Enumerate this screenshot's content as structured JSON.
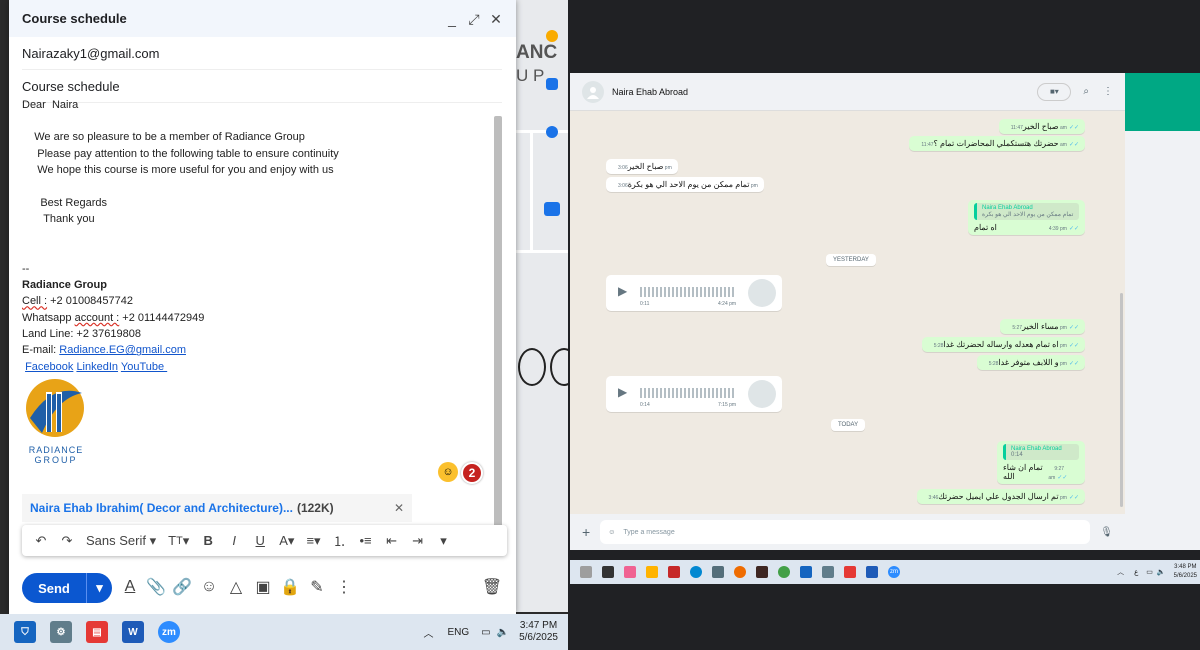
{
  "compose": {
    "title": "Course schedule",
    "to": "Nairazaky1@gmail.com",
    "subject": "Course schedule",
    "body_lines": [
      "Dear  Naira",
      "",
      "    We are so pleasure to be a member of Radiance Group",
      "     Please pay attention to the following table to ensure continuity",
      "     We hope this course is more useful for you and enjoy with us",
      "",
      "      Best Regards",
      "       Thank you",
      "",
      "",
      "--"
    ],
    "signature": {
      "company": "Radiance Group",
      "cell_label": "Cell :",
      "cell_value": " +2 01008457742",
      "whatsapp_label": "Whatsapp ",
      "whatsapp_account": "account :",
      "whatsapp_value": " +2 01144472949",
      "landline": "Land Line: +2 37619808",
      "email_label": "E-mail: ",
      "email_value": "Radiance.EG@gmail.com",
      "links": [
        "Facebook",
        "LinkedIn",
        "YouTube "
      ],
      "logo_text_1": "RADIANCE",
      "logo_text_2": "GROUP"
    },
    "badge_count": "2",
    "attachment_name": "Naira Ehab Ibrahim( Decor and Architecture)...",
    "attachment_size": "(122K)",
    "font_select": "Sans Serif",
    "send_label": "Send"
  },
  "map_letters": [
    "ANC",
    "U P"
  ],
  "taskbar_left": {
    "lang": "ENG",
    "time": "3:47 PM",
    "date": "5/6/2025",
    "zoom_label": "zm"
  },
  "chat": {
    "contact": "Naira Ehab Abroad",
    "messages": [
      {
        "dir": "out",
        "text": "صباح الخير",
        "time": "11:47 am"
      },
      {
        "dir": "out",
        "text": "حضرتك هتستكملي المحاضرات تمام ؟",
        "time": "11:47 am"
      },
      {
        "dir": "in",
        "text": "صباح الخير",
        "time": "3:06 pm"
      },
      {
        "dir": "in",
        "text": "تمام ممكن من يوم الاحد الي هو بكرة",
        "time": "3:06 pm"
      },
      {
        "dir": "out",
        "quote_name": "Naira Ehab Abroad",
        "quote_text": "تمام ممكن من يوم الاحد الي هو بكرة",
        "text": "اه تمام",
        "time": "4:39 pm"
      },
      {
        "dir": "out",
        "text": "مساء الخير",
        "time": "5:27 pm"
      },
      {
        "dir": "out",
        "text": "اه تمام هعدله وارساله لحضرتك غدا",
        "time": "5:28 pm"
      },
      {
        "dir": "out",
        "text": "و اللابف متوفر غدا",
        "time": "5:28 pm"
      },
      {
        "dir": "out",
        "quote_name": "Naira Ehab Abroad",
        "quote_text": "0:14",
        "text": "تمام ان شاء الله",
        "time": "9:27 am"
      },
      {
        "dir": "out",
        "text": "تم ارسال الجدول علي ايميل حضرتك",
        "time": "3:46 pm"
      }
    ],
    "yesterday": "YESTERDAY",
    "today": "TODAY",
    "voice1": {
      "duration": "0:11",
      "time": "4:24 pm"
    },
    "voice2": {
      "duration": "0:14",
      "time": "7:15 pm"
    },
    "input_placeholder": "Type a message"
  },
  "taskbar_right": {
    "lang": "ع",
    "time": "3:48 PM",
    "date": "5/6/2025",
    "zoom_label": "zm"
  }
}
